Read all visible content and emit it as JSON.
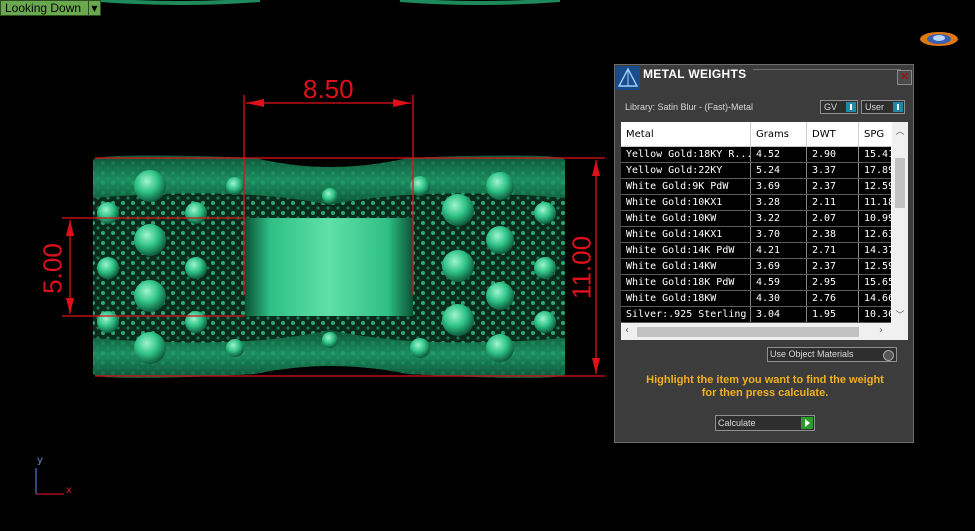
{
  "viewport": {
    "view_name": "Looking Down",
    "dimensions": {
      "width": "8.50",
      "height_left": "5.00",
      "height_right": "11.00"
    },
    "axis": {
      "x": "x",
      "y": "y"
    }
  },
  "dialog": {
    "title": "METAL WEIGHTS",
    "library_label": "Library: Satin Blur - (Fast)-Metal",
    "toggle_gv": "GV",
    "toggle_user": "User",
    "columns": [
      "Metal",
      "Grams",
      "DWT",
      "SPG"
    ],
    "rows": [
      [
        "Yellow Gold:18KY R...",
        "4.52",
        "2.90",
        "15.41"
      ],
      [
        "Yellow Gold:22KY",
        "5.24",
        "3.37",
        "17.89"
      ],
      [
        "White Gold:9K PdW",
        "3.69",
        "2.37",
        "12.59"
      ],
      [
        "White Gold:10KX1",
        "3.28",
        "2.11",
        "11.18"
      ],
      [
        "White Gold:10KW",
        "3.22",
        "2.07",
        "10.99"
      ],
      [
        "White Gold:14KX1",
        "3.70",
        "2.38",
        "12.63"
      ],
      [
        "White Gold:14K PdW",
        "4.21",
        "2.71",
        "14.37"
      ],
      [
        "White Gold:14KW",
        "3.69",
        "2.37",
        "12.59"
      ],
      [
        "White Gold:18K PdW",
        "4.59",
        "2.95",
        "15.65"
      ],
      [
        "White Gold:18KW",
        "4.30",
        "2.76",
        "14.66"
      ],
      [
        "Silver:.925 Sterling",
        "3.04",
        "1.95",
        "10.36"
      ]
    ],
    "use_object_materials": "Use Object Materials",
    "instruction_line1": "Highlight the item you want to find the weight",
    "instruction_line2": "for then press calculate.",
    "calculate_label": "Calculate",
    "close_glyph": "✕"
  },
  "colors": {
    "metal": "#1e9a66",
    "dimension": "#e0101a",
    "accent_text": "#f0b020"
  }
}
